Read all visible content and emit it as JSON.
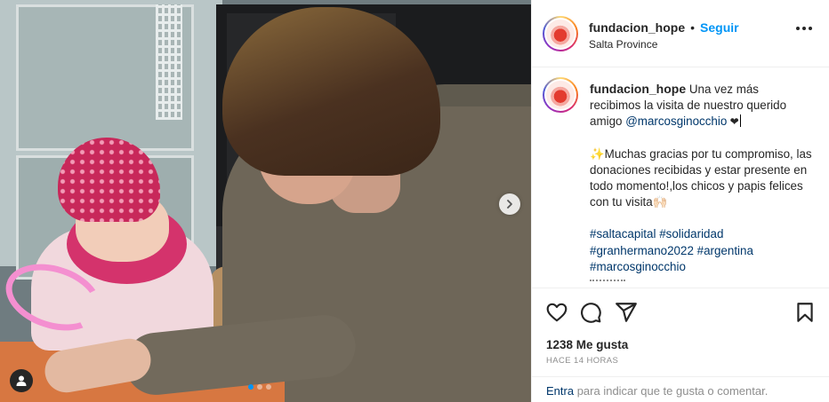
{
  "post": {
    "username": "fundacion_hope",
    "separator": "•",
    "follow_label": "Seguir",
    "location": "Salta Province"
  },
  "caption": {
    "username": "fundacion_hope",
    "line1_text": " Una vez más recibimos la visita de nuestro querido amigo ",
    "mention": "@marcosginocchio",
    "heart": " ❤",
    "para2": "✨Muchas gracias por tu compromiso, las donaciones recibidas y estar presente en todo momento!,los chicos y papis felices con tu visita🙌🏻",
    "hashtags": [
      "#saltacapital",
      "#solidaridad",
      "#granhermano2022",
      "#argentina",
      "#marcosginocchio"
    ]
  },
  "stats": {
    "likes": "1238 Me gusta",
    "time_ago": "HACE 14 HORAS"
  },
  "comment": {
    "entra": "Entra",
    "rest": " para indicar que te gusta o comentar."
  },
  "carousel": {
    "slide_count": 3,
    "active_index": 0
  },
  "icons": {
    "more": "more-options-icon",
    "like": "heart-icon",
    "comment": "comment-icon",
    "share": "share-icon",
    "save": "bookmark-icon",
    "next": "chevron-right-icon",
    "tags": "user-tag-icon"
  },
  "colors": {
    "link_blue": "#0095f6",
    "mention_blue": "#00376b",
    "muted": "#8e8e8e"
  }
}
